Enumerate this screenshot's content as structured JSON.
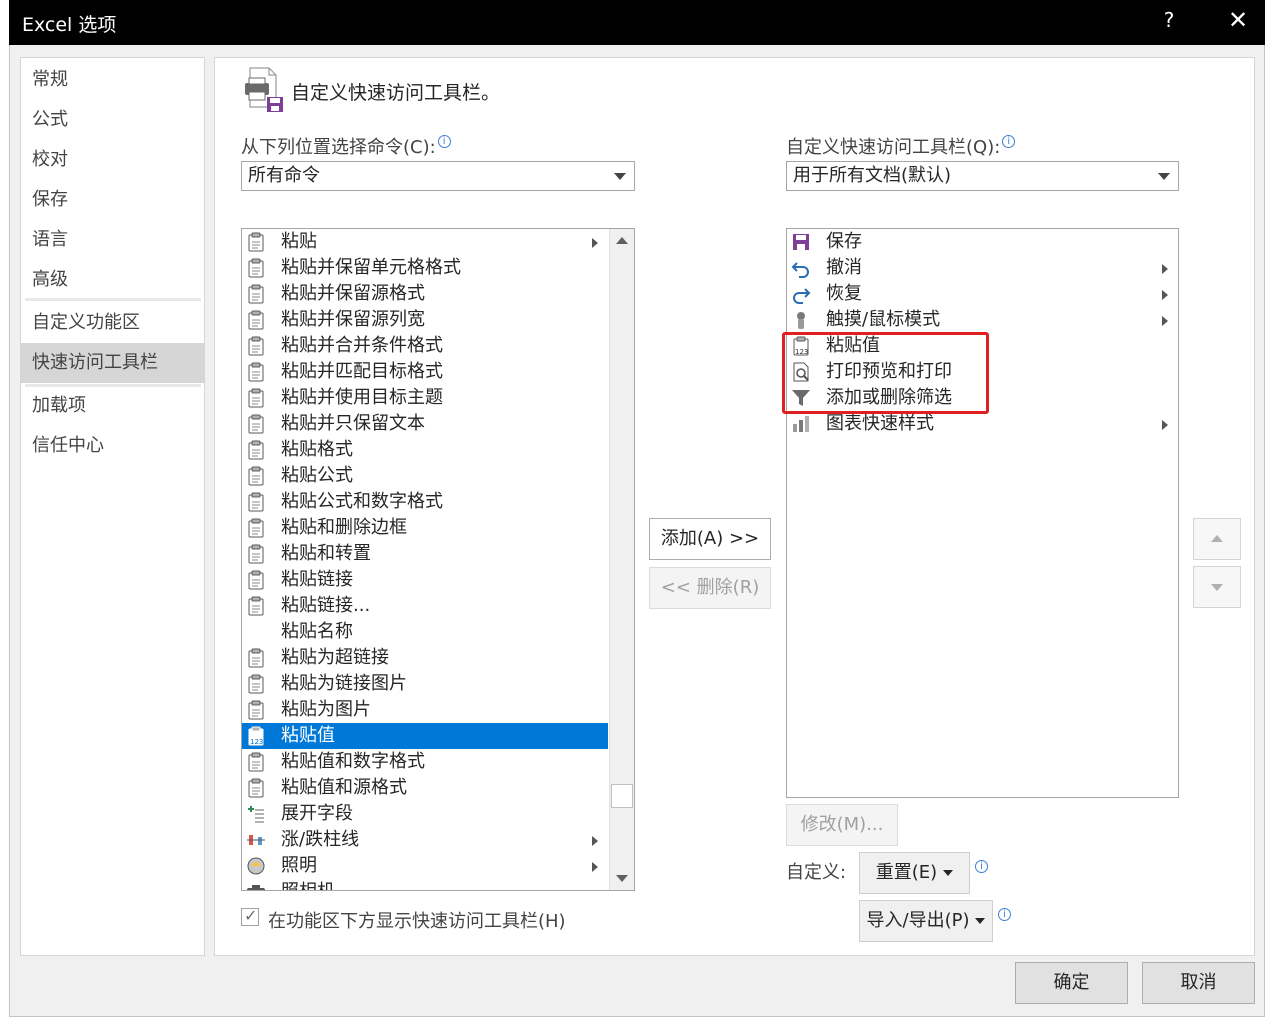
{
  "window": {
    "title": "Excel 选项",
    "help_label": "?",
    "close_label": "✕"
  },
  "nav": {
    "items": [
      "常规",
      "公式",
      "校对",
      "保存",
      "语言",
      "高级",
      "自定义功能区",
      "快速访问工具栏",
      "加载项",
      "信任中心"
    ],
    "active": "快速访问工具栏"
  },
  "heading": "自定义快速访问工具栏。",
  "left": {
    "label": "从下列位置选择命令(C):",
    "combo_value": "所有命令",
    "commands": [
      {
        "label": "粘贴",
        "icon": "paste-icon",
        "submenu": true
      },
      {
        "label": "粘贴并保留单元格格式",
        "icon": "paste-keep-formatting-icon"
      },
      {
        "label": "粘贴并保留源格式",
        "icon": "paste-keep-source-icon"
      },
      {
        "label": "粘贴并保留源列宽",
        "icon": "paste-keep-width-icon"
      },
      {
        "label": "粘贴并合并条件格式",
        "icon": "paste-merge-conditional-icon"
      },
      {
        "label": "粘贴并匹配目标格式",
        "icon": "paste-match-destination-icon"
      },
      {
        "label": "粘贴并使用目标主题",
        "icon": "paste-destination-theme-icon"
      },
      {
        "label": "粘贴并只保留文本",
        "icon": "paste-text-only-icon"
      },
      {
        "label": "粘贴格式",
        "icon": "paste-formatting-icon"
      },
      {
        "label": "粘贴公式",
        "icon": "paste-formulas-icon"
      },
      {
        "label": "粘贴公式和数字格式",
        "icon": "paste-formulas-number-icon"
      },
      {
        "label": "粘贴和删除边框",
        "icon": "paste-no-borders-icon"
      },
      {
        "label": "粘贴和转置",
        "icon": "paste-transpose-icon"
      },
      {
        "label": "粘贴链接",
        "icon": "paste-link-icon"
      },
      {
        "label": "粘贴链接...",
        "icon": "paste-link-dialog-icon"
      },
      {
        "label": "粘贴名称",
        "icon": ""
      },
      {
        "label": "粘贴为超链接",
        "icon": "paste-hyperlink-icon"
      },
      {
        "label": "粘贴为链接图片",
        "icon": "paste-linked-picture-icon"
      },
      {
        "label": "粘贴为图片",
        "icon": "paste-picture-icon"
      },
      {
        "label": "粘贴值",
        "icon": "paste-values-icon",
        "selected": true
      },
      {
        "label": "粘贴值和数字格式",
        "icon": "paste-values-number-icon"
      },
      {
        "label": "粘贴值和源格式",
        "icon": "paste-values-source-icon"
      },
      {
        "label": "展开字段",
        "icon": "expand-field-icon"
      },
      {
        "label": "涨/跌柱线",
        "icon": "up-down-bars-icon",
        "submenu": true
      },
      {
        "label": "照明",
        "icon": "lighting-icon",
        "submenu": true
      },
      {
        "label": "照相机",
        "icon": "camera-icon"
      }
    ]
  },
  "middle": {
    "add_label": "添加(A) >>",
    "remove_label": "<< 删除(R)"
  },
  "right": {
    "label": "自定义快速访问工具栏(Q):",
    "combo_value": "用于所有文档(默认)",
    "items": [
      {
        "label": "保存",
        "icon": "save-icon"
      },
      {
        "label": "撤消",
        "icon": "undo-icon",
        "submenu": true
      },
      {
        "label": "恢复",
        "icon": "redo-icon",
        "submenu": true
      },
      {
        "label": "触摸/鼠标模式",
        "icon": "touch-mode-icon",
        "submenu": true
      },
      {
        "label": "粘贴值",
        "icon": "paste-values-icon"
      },
      {
        "label": "打印预览和打印",
        "icon": "print-preview-icon"
      },
      {
        "label": "添加或删除筛选",
        "icon": "filter-icon"
      },
      {
        "label": "图表快速样式",
        "icon": "chart-styles-icon",
        "submenu": true
      }
    ],
    "modify_label": "修改(M)...",
    "customize_label": "自定义:",
    "reset_label": "重置(E)",
    "import_export_label": "导入/导出(P)"
  },
  "show_below_ribbon_label": "在功能区下方显示快速访问工具栏(H)",
  "show_below_ribbon_checked": true,
  "footer": {
    "ok_label": "确定",
    "cancel_label": "取消"
  },
  "colors": {
    "selection": "#0078d7",
    "highlight_box": "#e02020",
    "title_bar": "#000000"
  }
}
